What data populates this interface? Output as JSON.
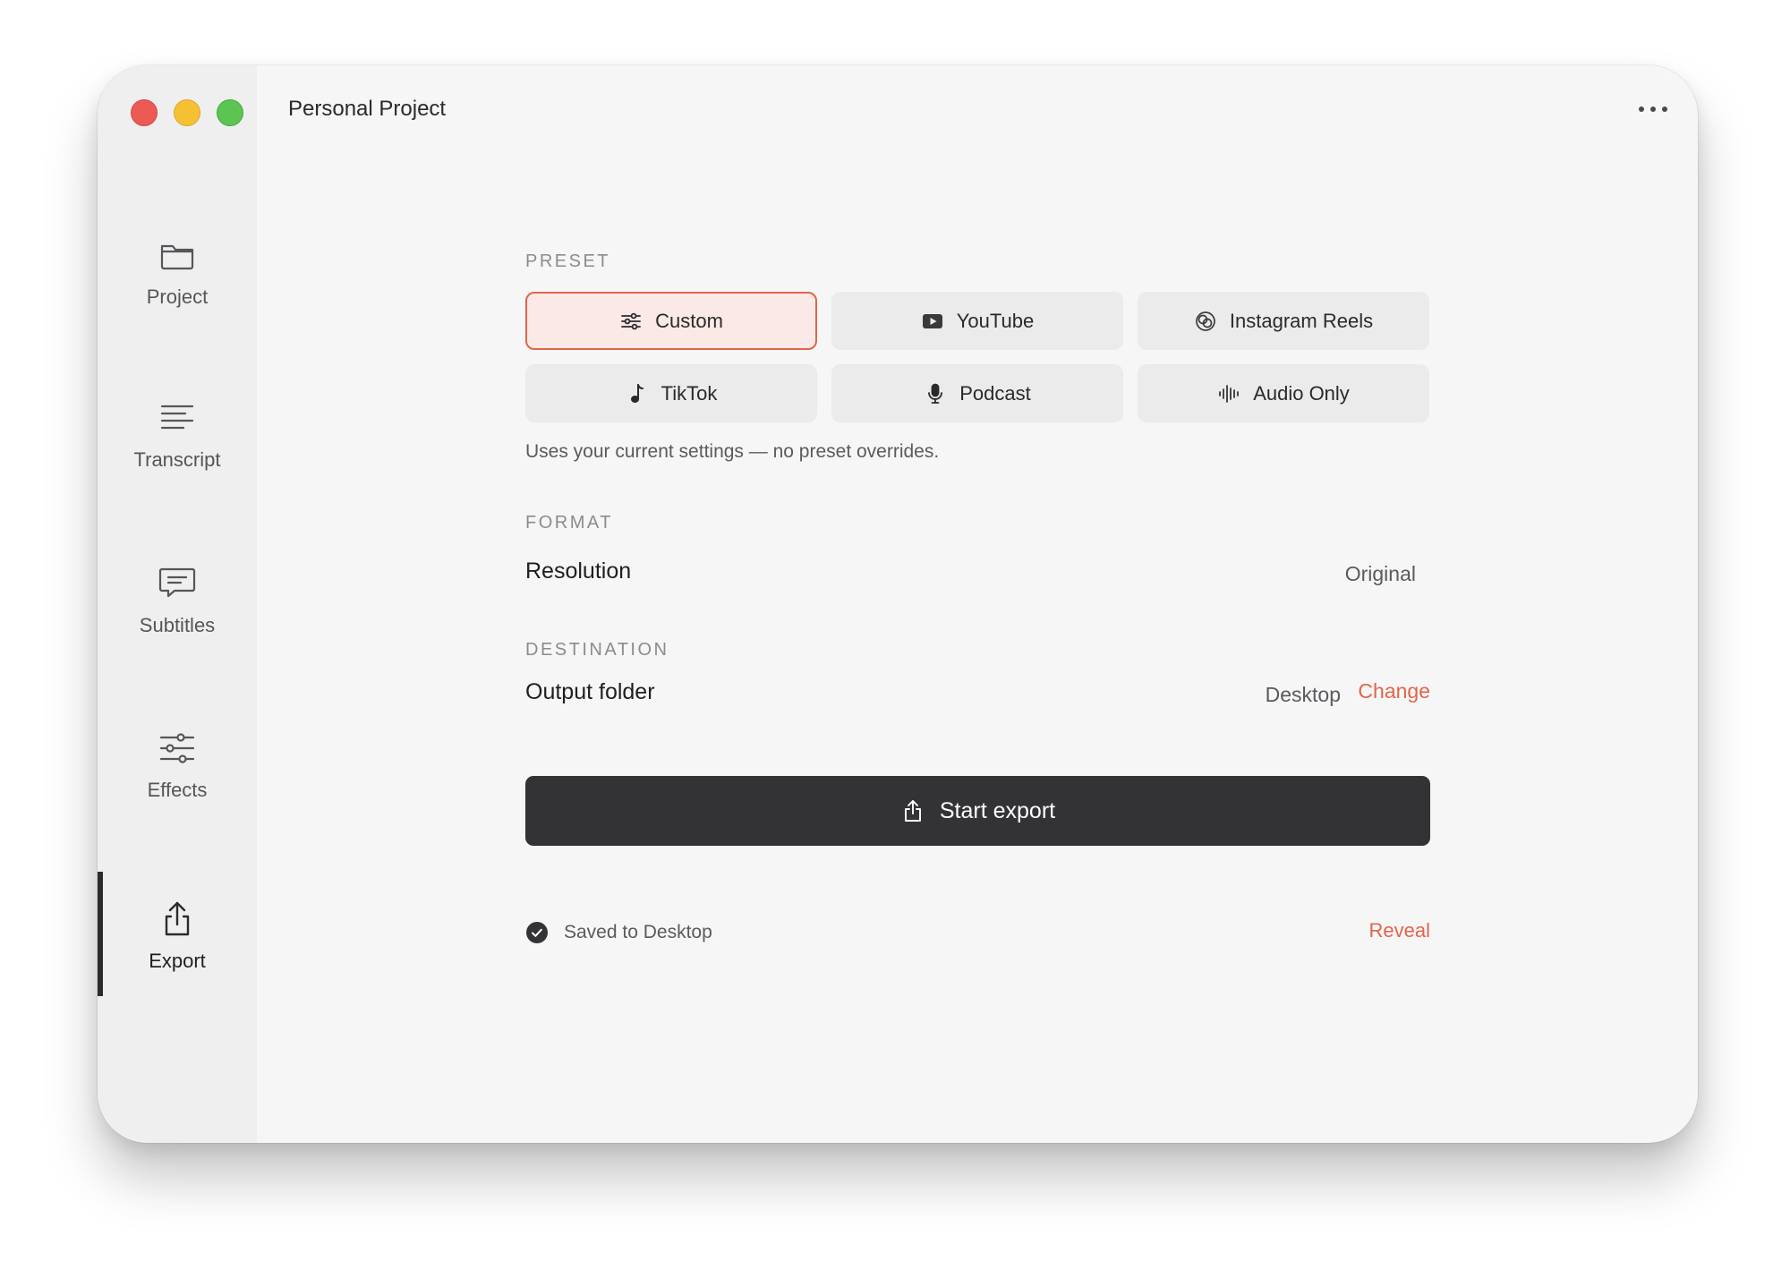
{
  "window": {
    "title": "Personal Project"
  },
  "sidebar": {
    "items": [
      {
        "label": "Project",
        "icon": "folder-icon",
        "active": false
      },
      {
        "label": "Transcript",
        "icon": "lines-icon",
        "active": false
      },
      {
        "label": "Subtitles",
        "icon": "chat-bubble-icon",
        "active": false
      },
      {
        "label": "Effects",
        "icon": "sliders-icon",
        "active": false
      },
      {
        "label": "Export",
        "icon": "share-icon",
        "active": true
      }
    ]
  },
  "preset": {
    "section_label": "PRESET",
    "options": [
      {
        "label": "Custom",
        "icon": "sliders-icon",
        "selected": true
      },
      {
        "label": "YouTube",
        "icon": "youtube-icon",
        "selected": false
      },
      {
        "label": "Instagram Reels",
        "icon": "reels-icon",
        "selected": false
      },
      {
        "label": "TikTok",
        "icon": "music-note-icon",
        "selected": false
      },
      {
        "label": "Podcast",
        "icon": "microphone-icon",
        "selected": false
      },
      {
        "label": "Audio Only",
        "icon": "waveform-icon",
        "selected": false
      }
    ],
    "helper_text": "Uses your current settings — no preset overrides."
  },
  "format": {
    "section_label": "FORMAT",
    "resolution_label": "Resolution",
    "resolution_value": "Original"
  },
  "destination": {
    "section_label": "DESTINATION",
    "output_label": "Output folder",
    "output_value": "Desktop",
    "change_label": "Change"
  },
  "export_button": {
    "label": "Start export",
    "icon": "share-icon"
  },
  "status": {
    "text": "Saved to Desktop",
    "icon": "check-circle-icon",
    "reveal_label": "Reveal"
  },
  "colors": {
    "accent": "#e0654a",
    "primary_button": "#333336",
    "selected_bg": "#fae9e6"
  }
}
